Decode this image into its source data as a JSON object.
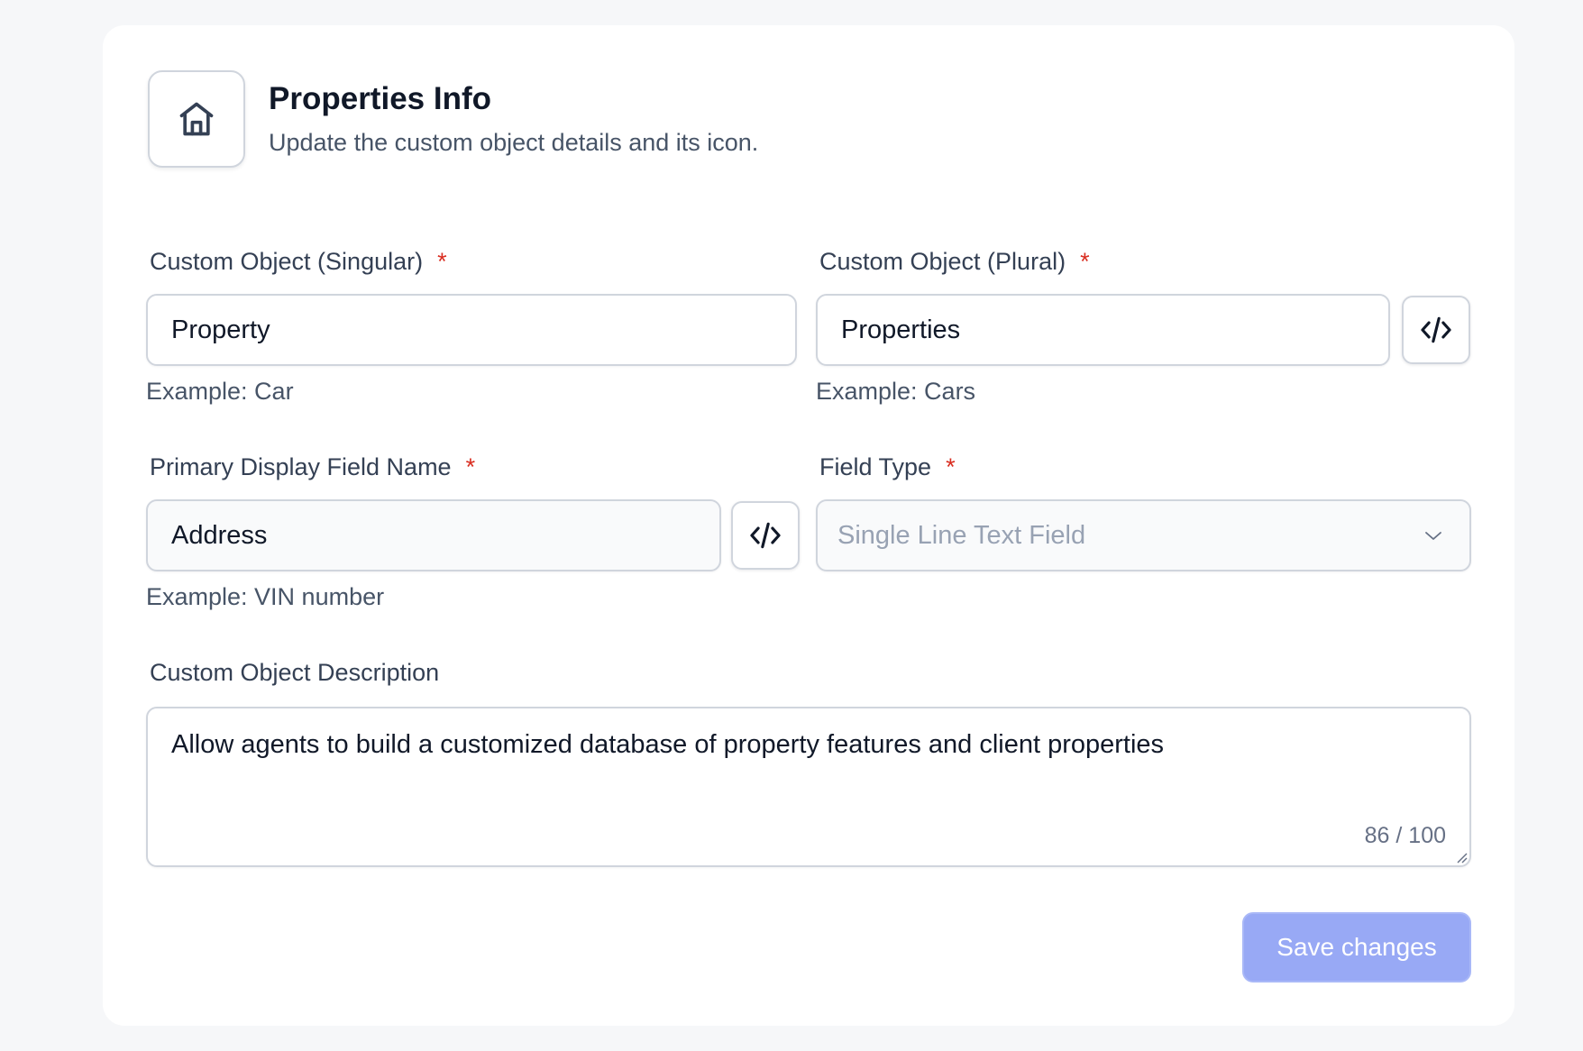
{
  "header": {
    "icon": "home-icon",
    "title": "Properties Info",
    "subtitle": "Update the custom object details and its icon."
  },
  "fields": {
    "singular": {
      "label": "Custom Object (Singular)",
      "required_mark": "*",
      "value": "Property",
      "hint": "Example: Car"
    },
    "plural": {
      "label": "Custom Object (Plural)",
      "required_mark": "*",
      "value": "Properties",
      "hint": "Example: Cars",
      "action_icon": "code-icon"
    },
    "primary_display": {
      "label": "Primary Display Field Name",
      "required_mark": "*",
      "value": "Address",
      "hint": "Example: VIN number",
      "action_icon": "code-icon"
    },
    "field_type": {
      "label": "Field Type",
      "required_mark": "*",
      "selected": "Single Line Text Field",
      "icon": "chevron-down-icon"
    },
    "description": {
      "label": "Custom Object Description",
      "value": "Allow agents to build a customized database of property features and client properties",
      "counter": "86 / 100"
    }
  },
  "actions": {
    "save_label": "Save changes"
  },
  "colors": {
    "required": "#d92d20",
    "save_button_bg": "#98a9f5",
    "border": "#d0d5dd"
  }
}
